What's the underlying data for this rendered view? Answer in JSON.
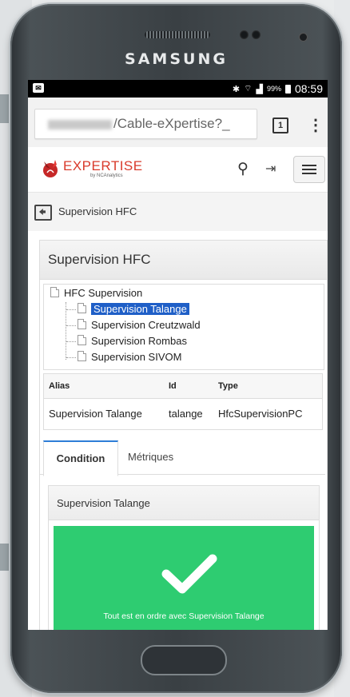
{
  "device": {
    "brand": "SAMSUNG"
  },
  "status_bar": {
    "battery_percent": "99%",
    "time": "08:59",
    "notification_icon": "notification-icon",
    "icons": [
      "bluetooth-icon",
      "wifi-icon",
      "signal-icon",
      "battery-icon"
    ]
  },
  "browser": {
    "url_visible": "/Cable-eXpertise?_",
    "tab_count": "1",
    "menu_glyph": "⋮"
  },
  "app": {
    "logo_text": "EXPERTISE",
    "logo_sub": "by NCAnalytics",
    "brand_color": "#d93a2b",
    "breadcrumb": "Supervision HFC"
  },
  "panel": {
    "title": "Supervision HFC",
    "tree": {
      "root": "HFC Supervision",
      "children": [
        "Supervision Talange",
        "Supervision Creutzwald",
        "Supervision Rombas",
        "Supervision SIVOM"
      ],
      "selected_index": 0
    },
    "grid": {
      "headers": [
        "Alias",
        "Id",
        "Type"
      ],
      "row": [
        "Supervision Talange",
        "talange",
        "HfcSupervisionPC"
      ]
    },
    "tabs": [
      "Condition",
      "Métriques"
    ],
    "active_tab": 0,
    "subpanel": {
      "title": "Supervision Talange",
      "status_color": "#2ecc71",
      "message": "Tout est en ordre avec Supervision Talange"
    }
  }
}
